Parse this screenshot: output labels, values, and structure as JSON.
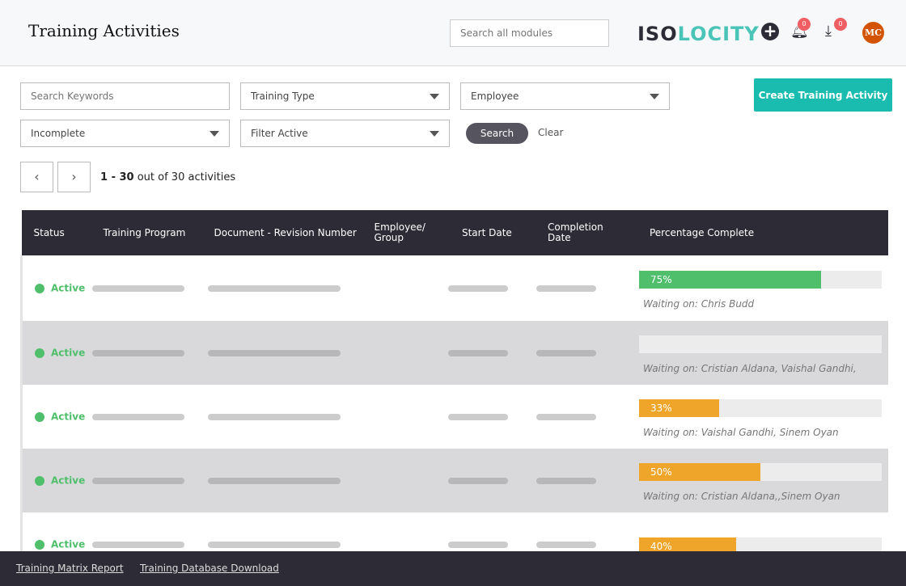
{
  "header": {
    "title": "Training Activities",
    "search_placeholder": "Search all modules",
    "logo_dark": "ISO",
    "logo_teal": "LOCITY",
    "notif_count": "0",
    "download_count": "0",
    "avatar": "MC"
  },
  "filters": {
    "keywords_placeholder": "Search Keywords",
    "training_type": "Training Type",
    "employee": "Employee",
    "status": "Incomplete",
    "active": "Filter Active",
    "search": "Search",
    "clear": "Clear",
    "create": "Create Training Activity"
  },
  "pagination": {
    "range": "1 - 30",
    "suffix": " out of 30 activities",
    "prev": "‹",
    "next": "›"
  },
  "table": {
    "headers": [
      "Status",
      "Training Program",
      "Document - Revision Number",
      "Employee/ Group",
      "Start Date",
      "Completion Date",
      "Percentage Complete"
    ],
    "rows": [
      {
        "status": "Active",
        "percent": 75,
        "percent_label": "75%",
        "color": "#4fbf6c",
        "waiting": "Waiting on: Chris Budd"
      },
      {
        "status": "Active",
        "percent": 0,
        "percent_label": "",
        "color": "#4fbf6c",
        "waiting": "Waiting on: Cristian Aldana, Vaishal Gandhi,"
      },
      {
        "status": "Active",
        "percent": 33,
        "percent_label": "33%",
        "color": "#eea52a",
        "waiting": "Waiting on: Vaishal Gandhi, Sinem Oyan"
      },
      {
        "status": "Active",
        "percent": 50,
        "percent_label": "50%",
        "color": "#eea52a",
        "waiting": "Waiting on: Cristian Aldana,,Sinem Oyan"
      },
      {
        "status": "Active",
        "percent": 40,
        "percent_label": "40%",
        "color": "#eea52a",
        "waiting": ""
      }
    ]
  },
  "footer": {
    "matrix": "Training Matrix Report",
    "download": "Training Database Download"
  }
}
